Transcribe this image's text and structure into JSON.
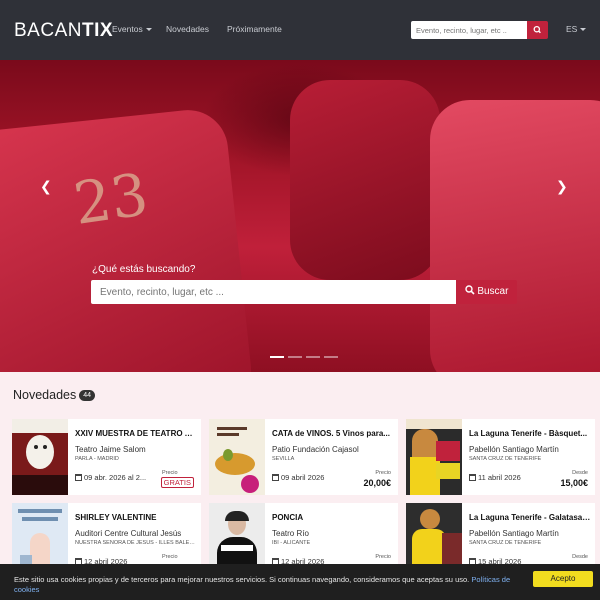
{
  "nav": {
    "logo_light": "BACAN",
    "logo_bold": "TIX",
    "items": [
      "Eventos",
      "Novedades",
      "Próximamente"
    ],
    "search_placeholder": "Evento, recinto, lugar, etc ..",
    "lang": "ES"
  },
  "hero": {
    "seat_number": "23",
    "search_label": "¿Qué estás buscando?",
    "search_placeholder": "Evento, recinto, lugar, etc ...",
    "search_button": "Buscar",
    "slides": 4,
    "active_slide": 0
  },
  "novedades": {
    "title": "Novedades",
    "count": "44",
    "cards": [
      {
        "title": "XXIV MUESTRA DE TEATRO AFICIONADO",
        "venue": "Teatro Jaime Salom",
        "city": "PARLA - MADRID",
        "date": "09 abr. 2026 al 2...",
        "price_label": "Precio",
        "price": "GRATIS",
        "free": true
      },
      {
        "title": "CATA de VINOS. 5 Vinos para...",
        "venue": "Patio Fundación Cajasol",
        "city": "SEVILLA",
        "date": "09 abril 2026",
        "price_label": "Precio",
        "price": "20,00€",
        "free": false
      },
      {
        "title": "La Laguna Tenerife - Bàsquet...",
        "venue": "Pabellón Santiago Martín",
        "city": "SANTA CRUZ DE TENERIFE",
        "date": "11 abril 2026",
        "price_label": "Desde",
        "price": "15,00€",
        "free": false
      },
      {
        "title": "SHIRLEY VALENTINE",
        "venue": "Auditori Centre Cultural Jesús",
        "city": "NUESTRA SEÑORA DE JESÚS - ILLES BALEARS",
        "date": "12 abril 2026",
        "price_label": "Precio",
        "price": "",
        "free": false
      },
      {
        "title": "PONCIA",
        "venue": "Teatro Río",
        "city": "IBI - ALICANTE",
        "date": "12 abril 2026",
        "price_label": "Precio",
        "price": "",
        "free": false
      },
      {
        "title": "La Laguna Tenerife - Galatasaray",
        "venue": "Pabellón Santiago Martín",
        "city": "SANTA CRUZ DE TENERIFE",
        "date": "15 abril 2026",
        "price_label": "Desde",
        "price": "",
        "free": false
      }
    ]
  },
  "cookies": {
    "text": "Este sitio usa cookies propias y de terceros para mejorar nuestros servicios. Si continuas navegando, consideramos que aceptas su uso.",
    "link": "Políticas de cookies",
    "button": "Acepto"
  }
}
